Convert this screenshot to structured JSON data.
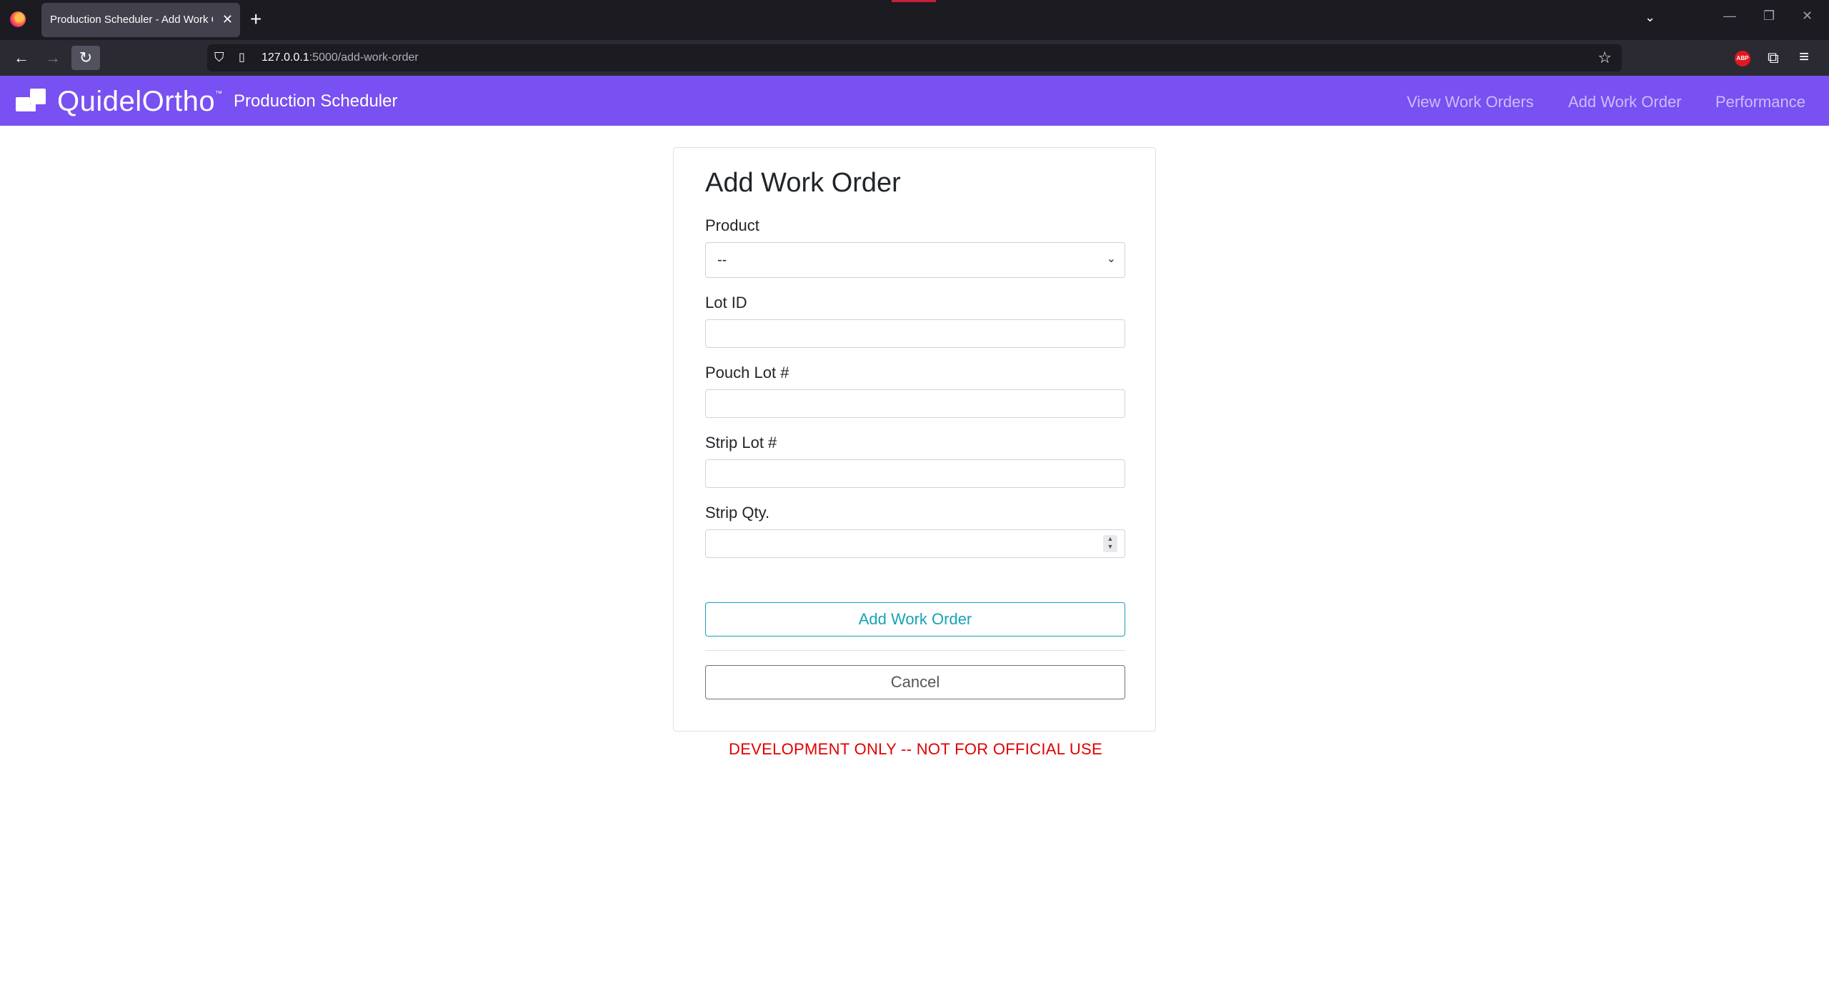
{
  "browser": {
    "tab_title": "Production Scheduler - Add Work Order",
    "url_host": "127.0.0.1",
    "url_path": ":5000/add-work-order",
    "icons": [
      "firefox-logo",
      "close-icon",
      "plus-icon",
      "chevron-down-icon",
      "back-icon",
      "forward-icon",
      "reload-icon",
      "shield-icon",
      "page-icon",
      "star-icon",
      "adblock-icon",
      "extensions-icon",
      "menu-icon"
    ]
  },
  "navbar": {
    "brand": "QuidelOrtho",
    "brand_tm": "™",
    "app_title": "Production Scheduler",
    "links": [
      "View Work Orders",
      "Add Work Order",
      "Performance"
    ],
    "color": "#7950f2"
  },
  "form": {
    "title": "Add Work Order",
    "product_label": "Product",
    "product_value": "--",
    "lot_id_label": "Lot ID",
    "pouch_lot_label": "Pouch Lot #",
    "strip_lot_label": "Strip Lot #",
    "strip_qty_label": "Strip Qty.",
    "submit_label": "Add Work Order",
    "cancel_label": "Cancel",
    "accent": "#17a2b8"
  },
  "footer": {
    "dev_note": "DEVELOPMENT ONLY -- NOT FOR OFFICIAL USE",
    "color": "#e00000"
  }
}
